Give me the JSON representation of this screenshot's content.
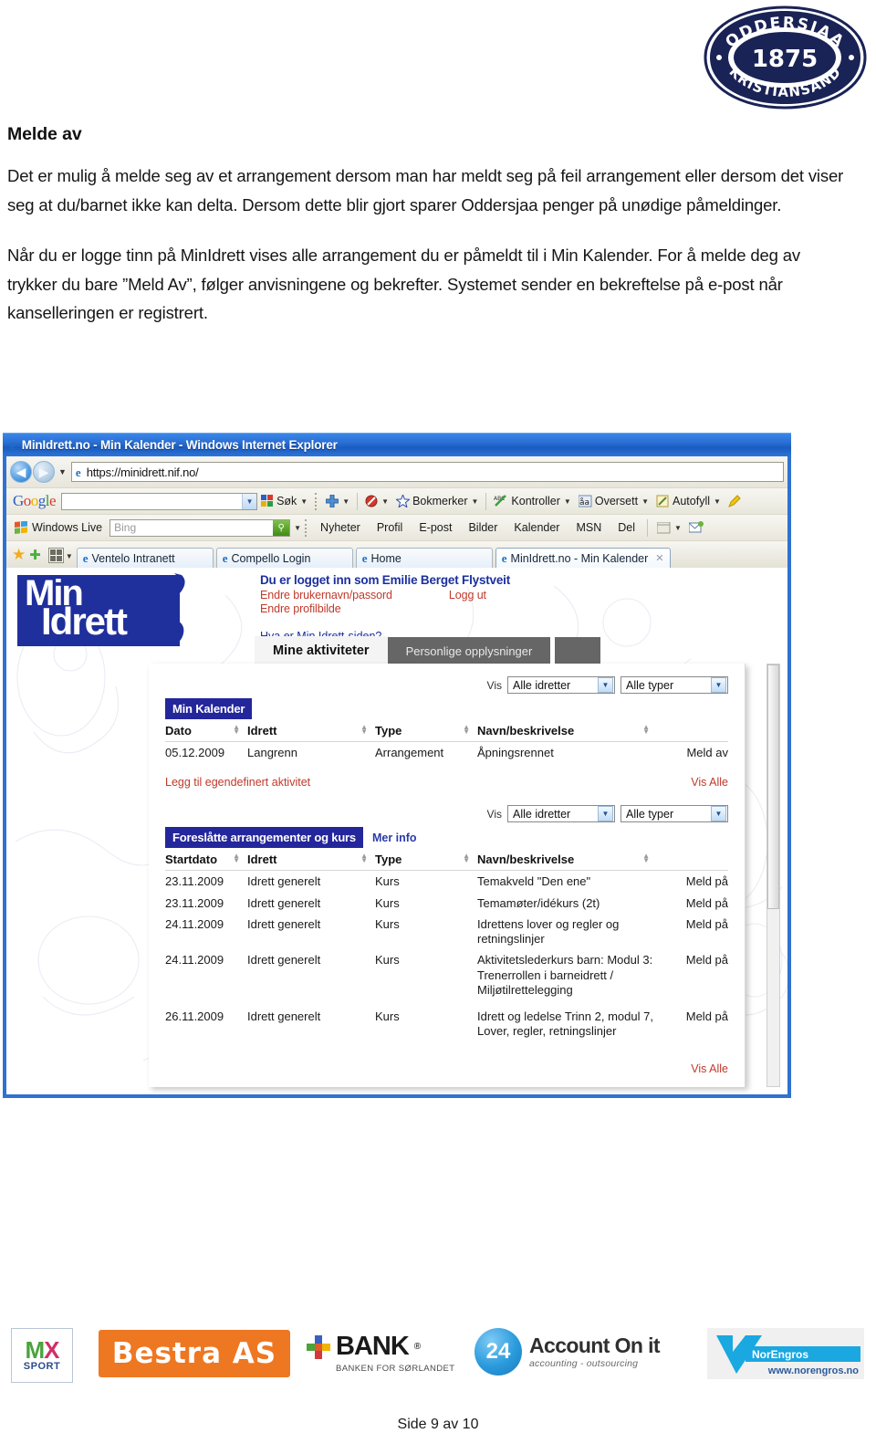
{
  "document": {
    "heading": "Melde av",
    "paragraph1": "Det er mulig å melde seg av et arrangement dersom man har meldt seg på feil arrangement eller dersom det viser seg at du/barnet ikke kan delta. Dersom dette blir gjort sparer Oddersjaa penger på unødige påmeldinger.",
    "paragraph2": "Når du er logge tinn på MinIdrett vises alle arrangement du er påmeldt til i Min Kalender. For å melde deg av trykker du bare ”Meld Av”, følger anvisningene og bekrefter. Systemet sender en bekreftelse på e-post når kanselleringen er registrert.",
    "footer": "Side 9 av 10"
  },
  "club_logo": {
    "top_text": "ODDERSJAA",
    "year": "1875",
    "bottom_text": "KRISTIANSAND",
    "color": "#1a2356"
  },
  "browser": {
    "title": "MinIdrett.no - Min Kalender - Windows Internet Explorer",
    "address": "https://minidrett.nif.no/",
    "google_toolbar": {
      "logo": "Google",
      "search_value": "",
      "items": [
        {
          "label": "Søk",
          "icon": "google-search-icon",
          "caret": true
        },
        {
          "label": "",
          "icon": "plus-icon",
          "caret": true
        },
        {
          "label": "",
          "icon": "popup-blocker-icon",
          "caret": true
        },
        {
          "label": "Bokmerker",
          "icon": "star-icon",
          "caret": true
        },
        {
          "label": "Kontroller",
          "icon": "spellcheck-icon",
          "caret": true
        },
        {
          "label": "Oversett",
          "icon": "translate-icon",
          "caret": true
        },
        {
          "label": "Autofyll",
          "icon": "autofill-icon",
          "caret": true
        }
      ]
    },
    "live_toolbar": {
      "brand": "Windows Live",
      "search_placeholder": "Bing",
      "search_value": "",
      "links": [
        "Nyheter",
        "Profil",
        "E-post",
        "Bilder",
        "Kalender",
        "MSN",
        "Del"
      ]
    },
    "tabs": [
      {
        "label": "Ventelo Intranett",
        "active": false,
        "closable": false
      },
      {
        "label": "Compello Login",
        "active": false,
        "closable": false
      },
      {
        "label": "Home",
        "active": false,
        "closable": false
      },
      {
        "label": "MinIdrett.no - Min Kalender",
        "active": true,
        "closable": true
      }
    ]
  },
  "minidrett": {
    "logo_line1": "Min",
    "logo_line2": "Idrett",
    "greeting": "Du er logget inn som Emilie Berget Flystveit",
    "link_change_credentials": "Endre brukernavn/passord",
    "link_logout": "Logg ut",
    "link_change_photo": "Endre profilbilde",
    "link_what_is": "Hva er Min Idrett-siden?",
    "tabs": [
      {
        "label": "Mine aktiviteter",
        "active": true
      },
      {
        "label": "Personlige opplysninger",
        "active": false
      }
    ],
    "filter_label": "Vis",
    "filter_sport": "Alle idretter",
    "filter_type": "Alle typer",
    "calendar": {
      "section_title": "Min Kalender",
      "columns": [
        "Dato",
        "Idrett",
        "Type",
        "Navn/beskrivelse",
        ""
      ],
      "rows": [
        {
          "dato": "05.12.2009",
          "idrett": "Langrenn",
          "type": "Arrangement",
          "navn": "Åpningsrennet",
          "action": "Meld av"
        }
      ]
    },
    "add_activity_link": "Legg til egendefinert aktivitet",
    "show_all_link": "Vis Alle",
    "suggested": {
      "section_title": "Foreslåtte arrangementer og kurs",
      "more_info": "Mer info",
      "columns": [
        "Startdato",
        "Idrett",
        "Type",
        "Navn/beskrivelse",
        ""
      ],
      "rows": [
        {
          "dato": "23.11.2009",
          "idrett": "Idrett generelt",
          "type": "Kurs",
          "navn": "Temakveld \"Den ene\"",
          "action": "Meld på"
        },
        {
          "dato": "23.11.2009",
          "idrett": "Idrett generelt",
          "type": "Kurs",
          "navn": "Temamøter/idékurs (2t)",
          "action": "Meld på"
        },
        {
          "dato": "24.11.2009",
          "idrett": "Idrett generelt",
          "type": "Kurs",
          "navn": "Idrettens lover og regler og retningslinjer",
          "action": "Meld på"
        },
        {
          "dato": "24.11.2009",
          "idrett": "Idrett generelt",
          "type": "Kurs",
          "navn": "Aktivitetslederkurs barn: Modul 3: Trenerrollen i barneidrett / Miljøtilrettelegging",
          "action": "Meld på"
        },
        {
          "dato": "26.11.2009",
          "idrett": "Idrett generelt",
          "type": "Kurs",
          "navn": "Idrett og ledelse Trinn 2, modul 7, Lover, regler, retningslinjer",
          "action": "Meld på"
        }
      ],
      "show_all_link": "Vis Alle"
    }
  },
  "sponsors": [
    {
      "name": "MX Sport",
      "line1": "MX",
      "line2": "SPORT"
    },
    {
      "name": "Bestra AS",
      "line1": "Bestra AS"
    },
    {
      "name": "Pluss Bank",
      "line1": "BANK",
      "line2": "BANKEN FOR SØRLANDET"
    },
    {
      "name": "24 Account On it",
      "badge": "24",
      "line1": "Account On it",
      "line2": "accounting - outsourcing"
    },
    {
      "name": "NorEngros",
      "line1": "NorEngros",
      "line2": "www.norengros.no"
    }
  ]
}
